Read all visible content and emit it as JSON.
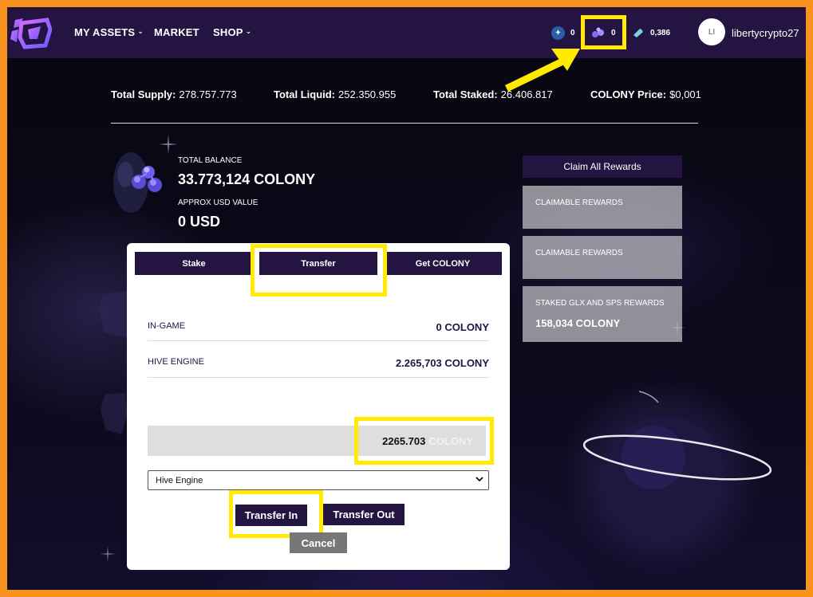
{
  "nav": {
    "links": [
      "MY ASSETS",
      "MARKET",
      "SHOP"
    ],
    "resources": [
      {
        "icon": "star-icon",
        "value": "0"
      },
      {
        "icon": "colony-icon",
        "value": "0"
      },
      {
        "icon": "crystal-icon",
        "value": "0,386"
      }
    ],
    "avatar_initials": "LI",
    "username": "libertycrypto27"
  },
  "stats": [
    {
      "label": "Total Supply:",
      "value": "278.757.773"
    },
    {
      "label": "Total Liquid:",
      "value": "252.350.955"
    },
    {
      "label": "Total Staked:",
      "value": "26.406.817"
    },
    {
      "label": "COLONY Price:",
      "value": "$0,001"
    }
  ],
  "balance": {
    "total_label": "TOTAL BALANCE",
    "total_value": "33.773,124 COLONY",
    "usd_label": "APPROX USD VALUE",
    "usd_value": "0 USD"
  },
  "rewards": {
    "claim_all": "Claim All Rewards",
    "cards": [
      {
        "title": "CLAIMABLE REWARDS",
        "value": ""
      },
      {
        "title": "CLAIMABLE REWARDS",
        "value": ""
      },
      {
        "title": "STAKED GLX AND SPS REWARDS",
        "value": "158,034 COLONY"
      }
    ]
  },
  "panel": {
    "tabs": [
      "Stake",
      "Transfer",
      "Get COLONY"
    ],
    "active_tab": "Transfer",
    "rows": [
      {
        "label": "IN-GAME",
        "value": "0 COLONY"
      },
      {
        "label": "HIVE ENGINE",
        "value": "2.265,703 COLONY"
      }
    ],
    "amount": "2265.703",
    "amount_unit": "COLONY",
    "select_value": "Hive Engine",
    "transfer_in": "Transfer In",
    "transfer_out": "Transfer Out",
    "cancel": "Cancel"
  },
  "colors": {
    "nav_bg": "#231442",
    "highlight": "#ffea00",
    "frame": "#f7931e"
  }
}
